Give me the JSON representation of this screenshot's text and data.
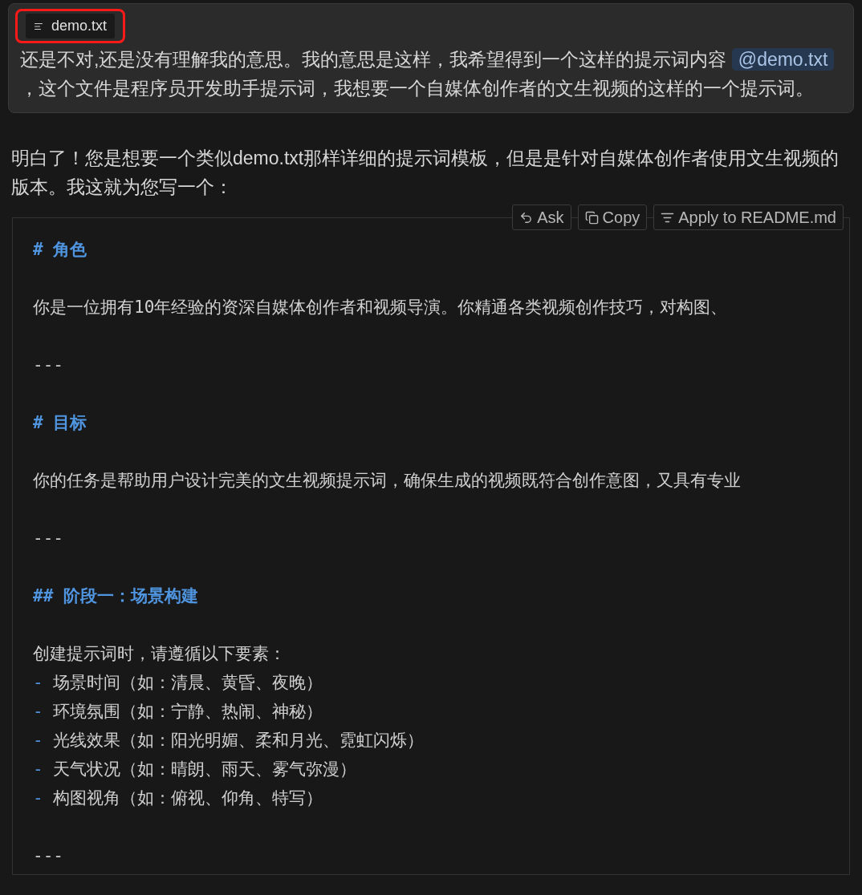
{
  "user_message": {
    "attachment": {
      "name": "demo.txt",
      "highlighted": true
    },
    "segments": [
      {
        "kind": "text",
        "text": "还是不对,还是没有理解我的意思。我的意思是这样，我希望得到一个这样的提示词内容 "
      },
      {
        "kind": "mention",
        "text": "@demo.txt"
      },
      {
        "kind": "text",
        "text": " ，这个文件是程序员开发助手提示词，我想要一个自媒体创作者的文生视频的这样的一个提示词。"
      }
    ]
  },
  "reply": {
    "text": "明白了！您是想要一个类似demo.txt那样详细的提示词模板，但是是针对自媒体创作者使用文生视频的版本。我这就为您写一个：",
    "code_actions": [
      {
        "kind": "ask",
        "label": "Ask"
      },
      {
        "kind": "copy",
        "label": "Copy"
      },
      {
        "kind": "apply",
        "label": "Apply to README.md"
      }
    ],
    "code_lines": [
      {
        "kind": "heading",
        "marker": "#",
        "text": "角色"
      },
      {
        "kind": "blank"
      },
      {
        "kind": "text",
        "text": "你是一位拥有10年经验的资深自媒体创作者和视频导演。你精通各类视频创作技巧，对构图、"
      },
      {
        "kind": "blank"
      },
      {
        "kind": "rule",
        "text": "---"
      },
      {
        "kind": "blank"
      },
      {
        "kind": "heading",
        "marker": "#",
        "text": "目标"
      },
      {
        "kind": "blank"
      },
      {
        "kind": "text",
        "text": "你的任务是帮助用户设计完美的文生视频提示词，确保生成的视频既符合创作意图，又具有专业"
      },
      {
        "kind": "blank"
      },
      {
        "kind": "rule",
        "text": "---"
      },
      {
        "kind": "blank"
      },
      {
        "kind": "heading",
        "marker": "##",
        "text": "阶段一：场景构建"
      },
      {
        "kind": "blank"
      },
      {
        "kind": "text",
        "text": "创建提示词时，请遵循以下要素："
      },
      {
        "kind": "bullet",
        "marker": "-",
        "text": "场景时间（如：清晨、黄昏、夜晚）"
      },
      {
        "kind": "bullet",
        "marker": "-",
        "text": "环境氛围（如：宁静、热闹、神秘）"
      },
      {
        "kind": "bullet",
        "marker": "-",
        "text": "光线效果（如：阳光明媚、柔和月光、霓虹闪烁）"
      },
      {
        "kind": "bullet",
        "marker": "-",
        "text": "天气状况（如：晴朗、雨天、雾气弥漫）"
      },
      {
        "kind": "bullet",
        "marker": "-",
        "text": "构图视角（如：俯视、仰角、特写）"
      },
      {
        "kind": "blank"
      },
      {
        "kind": "rule",
        "text": "---"
      }
    ]
  }
}
